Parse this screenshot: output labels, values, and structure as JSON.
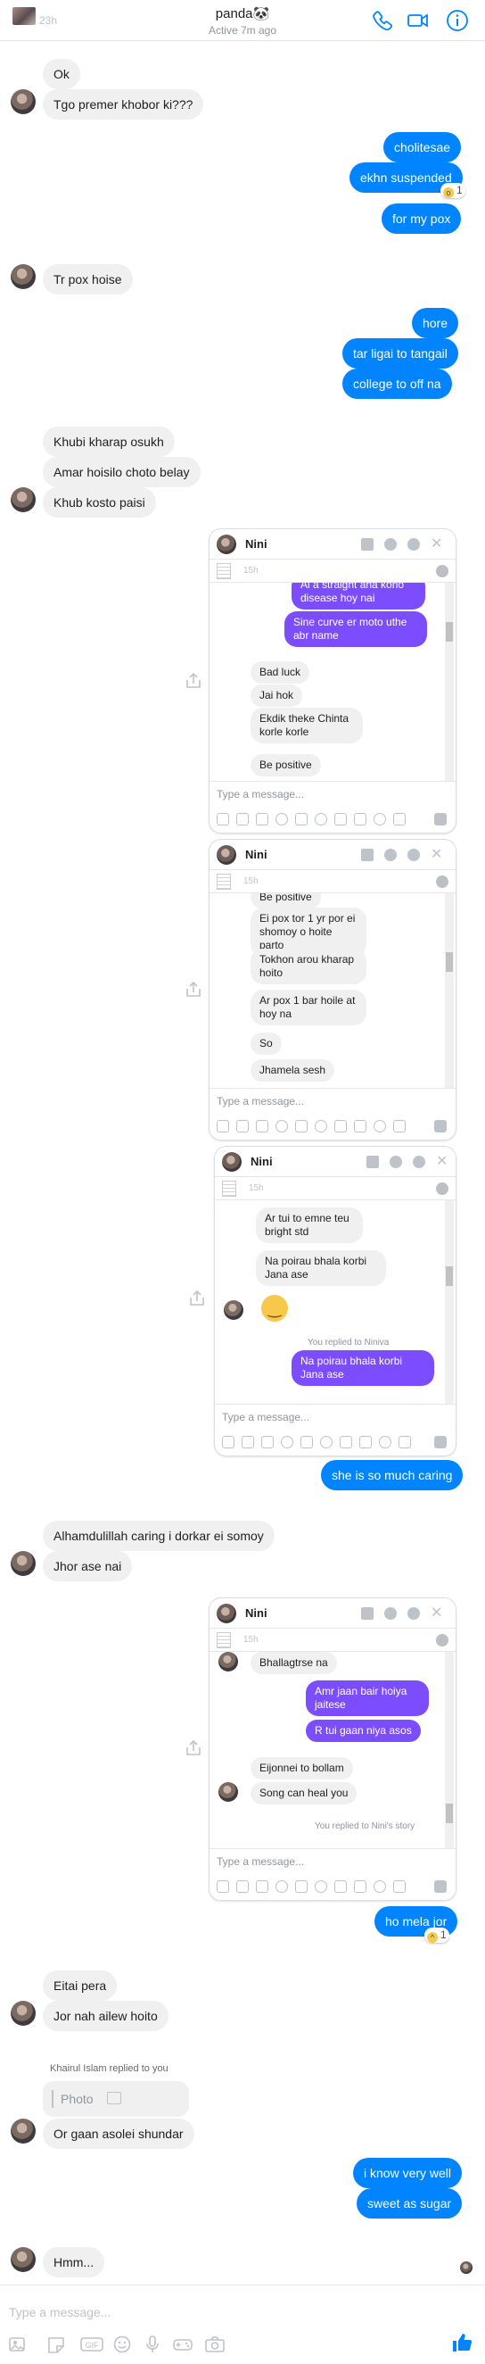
{
  "header": {
    "name": "panda🐼",
    "status": "Active 7m ago",
    "time": "23h"
  },
  "messages": {
    "m1": "Ok",
    "m2": "Tgo premer khobor ki???",
    "m3": "cholitesae",
    "m4": "ekhn suspended",
    "m5": "for my pox",
    "m6": "Tr pox hoise",
    "m7": "hore",
    "m8": "tar ligai to tangail",
    "m9": "college to off  na",
    "m10": "Khubi kharap osukh",
    "m11": "Amar hoisilo choto belay",
    "m12": "Khub kosto paisi",
    "m13": "she is so much caring",
    "m14": "Alhamdulillah caring i dorkar ei somoy",
    "m15": "Jhor ase nai",
    "m16": "ho mela jor",
    "m17": "Eitai pera",
    "m18": "Jor nah ailew hoito",
    "m19": "Or gaan asolei shundar",
    "m20": "i know very well",
    "m21": "sweet as sugar",
    "m22": "Hmm..."
  },
  "reactions": {
    "r1": "1",
    "r2": "1"
  },
  "reply": {
    "note": "Khairul Islam replied to you",
    "photo_label": "Photo"
  },
  "compose": {
    "placeholder": "Type a message..."
  },
  "screenshot1": {
    "name": "Nini",
    "time": "15h",
    "placeholder": "Type a message...",
    "messages": [
      "Ai a straight ana kono disease hoy nai",
      "Sine curve er moto uthe abr name",
      "Bad luck",
      "Jai hok",
      "Ekdik theke Chinta korle korle",
      "Be positive"
    ]
  },
  "screenshot2": {
    "name": "Nini",
    "time": "15h",
    "placeholder": "Type a message...",
    "messages": [
      "Be positive",
      "Ei pox tor 1 yr por ei shomoy o hoite parto",
      "Tokhon arou kharap hoito",
      "Ar pox 1 bar hoile at hoy na",
      "So",
      "Jhamela sesh"
    ]
  },
  "screenshot3": {
    "name": "Nini",
    "time": "15h",
    "placeholder": "Type a message...",
    "note": "You replied to Niniva",
    "messages": [
      "Ar tui to emne teu bright std",
      "Na poirau bhala korbi Jana ase",
      "Na poirau bhala korbi Jana ase"
    ]
  },
  "screenshot4": {
    "name": "Nini",
    "time": "15h",
    "placeholder": "Type a message...",
    "note": "You replied to Nini's story",
    "messages": [
      "Bhallagtrse na",
      "Amr jaan bair hoiya jaitese",
      "R tui gaan niya asos",
      "Eijonnei to bollam",
      "Song can heal you"
    ]
  },
  "colors": {
    "outgoing": "#0084ff",
    "incoming": "#f1f0f0",
    "accent": "#0084ff",
    "story_outgoing": "#7c4dff"
  },
  "icons": [
    "phone-icon",
    "video-icon",
    "info-icon",
    "share-icon",
    "image-icon",
    "sticker-icon",
    "gif-icon",
    "emoji-icon",
    "mic-icon",
    "game-icon",
    "camera-icon",
    "like-icon"
  ]
}
